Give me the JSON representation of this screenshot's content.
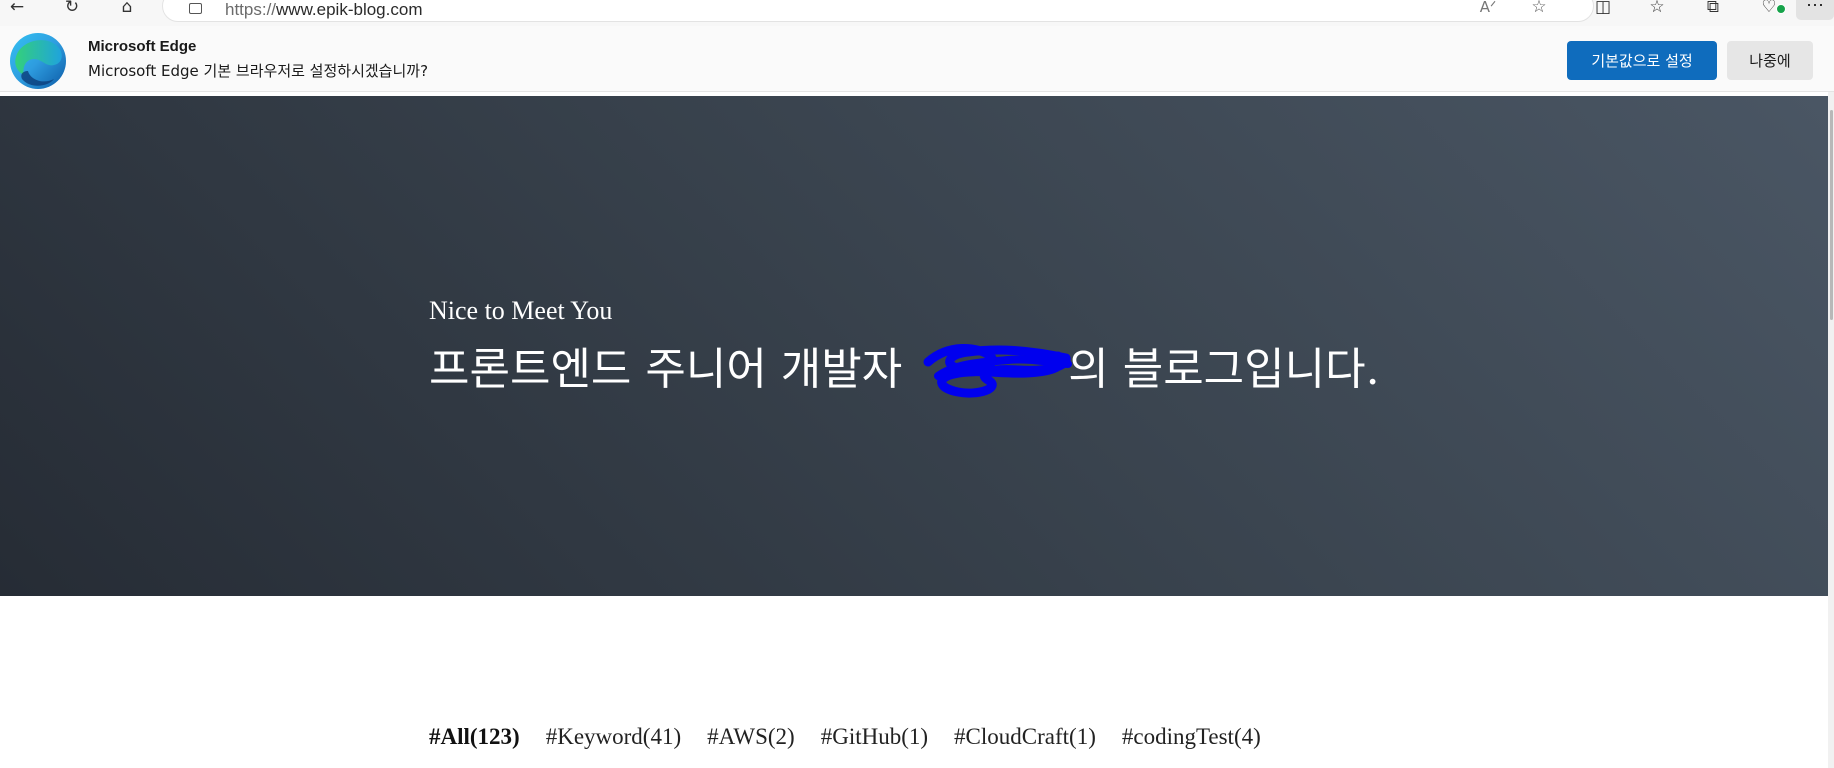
{
  "browser": {
    "url_prefix": "https://",
    "url_host": "www.epik-blog.com",
    "icons": [
      "back-icon",
      "refresh-icon",
      "home-icon",
      "read-aloud-icon",
      "favorite-star-icon",
      "split-screen-icon",
      "favorites-icon",
      "collections-icon",
      "browser-essentials-icon",
      "more-icon"
    ]
  },
  "infobar": {
    "title": "Microsoft Edge",
    "message": "Microsoft Edge 기본 브라우저로 설정하시겠습니까?",
    "primary_button": "기본값으로 설정",
    "secondary_button": "나중에"
  },
  "hero": {
    "subtitle": "Nice to Meet You",
    "title_before": "프론트엔드 주니어 개발자 ",
    "title_after": "의 블로그입니다."
  },
  "tags": [
    {
      "label": "#All(123)",
      "active": true
    },
    {
      "label": "#Keyword(41)",
      "active": false
    },
    {
      "label": "#AWS(2)",
      "active": false
    },
    {
      "label": "#GitHub(1)",
      "active": false
    },
    {
      "label": "#CloudCraft(1)",
      "active": false
    },
    {
      "label": "#codingTest(4)",
      "active": false
    }
  ],
  "colors": {
    "accent": "#0f6cbd",
    "hero_dark": "#262c35",
    "hero_light": "#4a5664",
    "redaction": "#0000ee"
  }
}
